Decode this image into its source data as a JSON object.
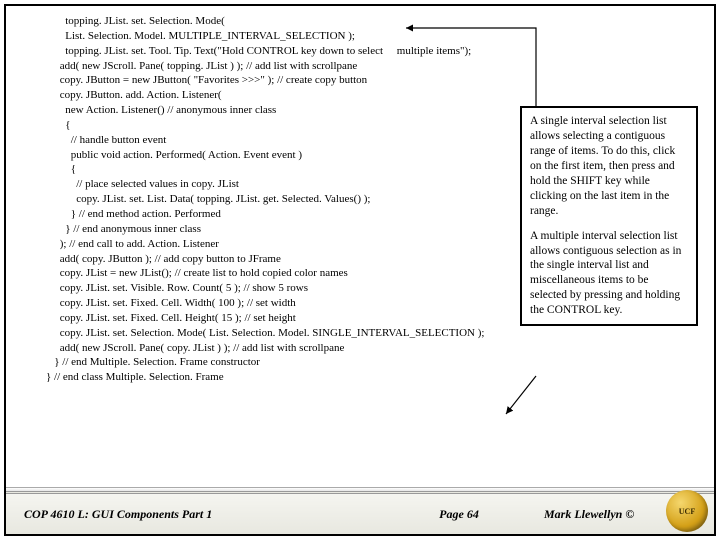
{
  "code": {
    "l1": "       topping. JList. set. Selection. Mode(",
    "l2": "       List. Selection. Model. MULTIPLE_INTERVAL_SELECTION );",
    "l3": "       topping. JList. set. Tool. Tip. Text(\"Hold CONTROL key down to select     multiple items\");",
    "l4": "     add( new JScroll. Pane( topping. JList ) ); // add list with scrollpane",
    "l5": "",
    "l6": "     copy. JButton = new JButton( \"Favorites >>>\" ); // create copy button",
    "l7": "     copy. JButton. add. Action. Listener(",
    "l8": "       new Action. Listener() // anonymous inner class",
    "l9": "       {",
    "l10": "         // handle button event",
    "l11": "         public void action. Performed( Action. Event event )",
    "l12": "         {",
    "l13": "           // place selected values in copy. JList",
    "l14": "           copy. JList. set. List. Data( topping. JList. get. Selected. Values() );",
    "l15": "         } // end method action. Performed",
    "l16": "       } // end anonymous inner class",
    "l17": "     ); // end call to add. Action. Listener",
    "l18": "",
    "l19": "     add( copy. JButton ); // add copy button to JFrame",
    "l20": "     copy. JList = new JList(); // create list to hold copied color names",
    "l21": "     copy. JList. set. Visible. Row. Count( 5 ); // show 5 rows",
    "l22": "     copy. JList. set. Fixed. Cell. Width( 100 ); // set width",
    "l23": "     copy. JList. set. Fixed. Cell. Height( 15 ); // set height",
    "l24": "     copy. JList. set. Selection. Mode( List. Selection. Model. SINGLE_INTERVAL_SELECTION );",
    "l25": "     add( new JScroll. Pane( copy. JList ) ); // add list with scrollpane",
    "l26": "   } // end Multiple. Selection. Frame constructor",
    "l27": "} // end class Multiple. Selection. Frame"
  },
  "annotation": {
    "p1": "A single interval selection list allows selecting a contiguous range of items. To do this, click on the first item, then press and hold the SHIFT key while clicking on the last item in the range.",
    "p2": "A multiple interval selection list allows contiguous selection as in the single interval list and miscellaneous items to be selected by pressing and holding the CONTROL key."
  },
  "footer": {
    "course": "COP 4610 L: GUI Components Part 1",
    "page": "Page 64",
    "author": "Mark Llewellyn ©"
  }
}
